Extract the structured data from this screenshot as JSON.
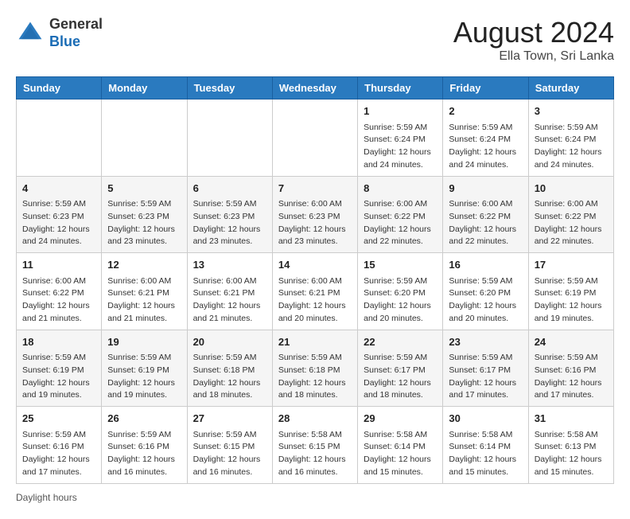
{
  "header": {
    "logo_general": "General",
    "logo_blue": "Blue",
    "month_year": "August 2024",
    "location": "Ella Town, Sri Lanka"
  },
  "days_of_week": [
    "Sunday",
    "Monday",
    "Tuesday",
    "Wednesday",
    "Thursday",
    "Friday",
    "Saturday"
  ],
  "weeks": [
    [
      {
        "day": "",
        "info": ""
      },
      {
        "day": "",
        "info": ""
      },
      {
        "day": "",
        "info": ""
      },
      {
        "day": "",
        "info": ""
      },
      {
        "day": "1",
        "info": "Sunrise: 5:59 AM\nSunset: 6:24 PM\nDaylight: 12 hours\nand 24 minutes."
      },
      {
        "day": "2",
        "info": "Sunrise: 5:59 AM\nSunset: 6:24 PM\nDaylight: 12 hours\nand 24 minutes."
      },
      {
        "day": "3",
        "info": "Sunrise: 5:59 AM\nSunset: 6:24 PM\nDaylight: 12 hours\nand 24 minutes."
      }
    ],
    [
      {
        "day": "4",
        "info": "Sunrise: 5:59 AM\nSunset: 6:23 PM\nDaylight: 12 hours\nand 24 minutes."
      },
      {
        "day": "5",
        "info": "Sunrise: 5:59 AM\nSunset: 6:23 PM\nDaylight: 12 hours\nand 23 minutes."
      },
      {
        "day": "6",
        "info": "Sunrise: 5:59 AM\nSunset: 6:23 PM\nDaylight: 12 hours\nand 23 minutes."
      },
      {
        "day": "7",
        "info": "Sunrise: 6:00 AM\nSunset: 6:23 PM\nDaylight: 12 hours\nand 23 minutes."
      },
      {
        "day": "8",
        "info": "Sunrise: 6:00 AM\nSunset: 6:22 PM\nDaylight: 12 hours\nand 22 minutes."
      },
      {
        "day": "9",
        "info": "Sunrise: 6:00 AM\nSunset: 6:22 PM\nDaylight: 12 hours\nand 22 minutes."
      },
      {
        "day": "10",
        "info": "Sunrise: 6:00 AM\nSunset: 6:22 PM\nDaylight: 12 hours\nand 22 minutes."
      }
    ],
    [
      {
        "day": "11",
        "info": "Sunrise: 6:00 AM\nSunset: 6:22 PM\nDaylight: 12 hours\nand 21 minutes."
      },
      {
        "day": "12",
        "info": "Sunrise: 6:00 AM\nSunset: 6:21 PM\nDaylight: 12 hours\nand 21 minutes."
      },
      {
        "day": "13",
        "info": "Sunrise: 6:00 AM\nSunset: 6:21 PM\nDaylight: 12 hours\nand 21 minutes."
      },
      {
        "day": "14",
        "info": "Sunrise: 6:00 AM\nSunset: 6:21 PM\nDaylight: 12 hours\nand 20 minutes."
      },
      {
        "day": "15",
        "info": "Sunrise: 5:59 AM\nSunset: 6:20 PM\nDaylight: 12 hours\nand 20 minutes."
      },
      {
        "day": "16",
        "info": "Sunrise: 5:59 AM\nSunset: 6:20 PM\nDaylight: 12 hours\nand 20 minutes."
      },
      {
        "day": "17",
        "info": "Sunrise: 5:59 AM\nSunset: 6:19 PM\nDaylight: 12 hours\nand 19 minutes."
      }
    ],
    [
      {
        "day": "18",
        "info": "Sunrise: 5:59 AM\nSunset: 6:19 PM\nDaylight: 12 hours\nand 19 minutes."
      },
      {
        "day": "19",
        "info": "Sunrise: 5:59 AM\nSunset: 6:19 PM\nDaylight: 12 hours\nand 19 minutes."
      },
      {
        "day": "20",
        "info": "Sunrise: 5:59 AM\nSunset: 6:18 PM\nDaylight: 12 hours\nand 18 minutes."
      },
      {
        "day": "21",
        "info": "Sunrise: 5:59 AM\nSunset: 6:18 PM\nDaylight: 12 hours\nand 18 minutes."
      },
      {
        "day": "22",
        "info": "Sunrise: 5:59 AM\nSunset: 6:17 PM\nDaylight: 12 hours\nand 18 minutes."
      },
      {
        "day": "23",
        "info": "Sunrise: 5:59 AM\nSunset: 6:17 PM\nDaylight: 12 hours\nand 17 minutes."
      },
      {
        "day": "24",
        "info": "Sunrise: 5:59 AM\nSunset: 6:16 PM\nDaylight: 12 hours\nand 17 minutes."
      }
    ],
    [
      {
        "day": "25",
        "info": "Sunrise: 5:59 AM\nSunset: 6:16 PM\nDaylight: 12 hours\nand 17 minutes."
      },
      {
        "day": "26",
        "info": "Sunrise: 5:59 AM\nSunset: 6:16 PM\nDaylight: 12 hours\nand 16 minutes."
      },
      {
        "day": "27",
        "info": "Sunrise: 5:59 AM\nSunset: 6:15 PM\nDaylight: 12 hours\nand 16 minutes."
      },
      {
        "day": "28",
        "info": "Sunrise: 5:58 AM\nSunset: 6:15 PM\nDaylight: 12 hours\nand 16 minutes."
      },
      {
        "day": "29",
        "info": "Sunrise: 5:58 AM\nSunset: 6:14 PM\nDaylight: 12 hours\nand 15 minutes."
      },
      {
        "day": "30",
        "info": "Sunrise: 5:58 AM\nSunset: 6:14 PM\nDaylight: 12 hours\nand 15 minutes."
      },
      {
        "day": "31",
        "info": "Sunrise: 5:58 AM\nSunset: 6:13 PM\nDaylight: 12 hours\nand 15 minutes."
      }
    ]
  ],
  "footer": {
    "daylight_label": "Daylight hours"
  }
}
